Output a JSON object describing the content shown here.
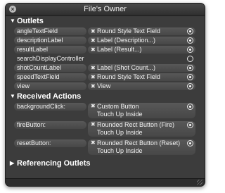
{
  "window": {
    "title": "File's Owner"
  },
  "sections": {
    "outlets": "Outlets",
    "received_actions": "Received Actions",
    "referencing_outlets": "Referencing Outlets"
  },
  "outlets": [
    {
      "name": "angleTextField",
      "target": "Round Style Text Field",
      "connected": true
    },
    {
      "name": "descriptionLabel",
      "target": "Label (Description...)",
      "connected": true
    },
    {
      "name": "resultLabel",
      "target": "Label (Result...)",
      "connected": true
    },
    {
      "name": "searchDisplayController",
      "target": "",
      "connected": false
    },
    {
      "name": "shotCountLabel",
      "target": "Label (Shot Count...)",
      "connected": true
    },
    {
      "name": "speedTextField",
      "target": "Round Style Text Field",
      "connected": true
    },
    {
      "name": "view",
      "target": "View",
      "connected": true
    }
  ],
  "actions": [
    {
      "name": "backgroundClick:",
      "target": "Custom Button",
      "event": "Touch Up Inside"
    },
    {
      "name": "fireButton:",
      "target": "Rounded Rect Button (Fire)",
      "event": "Touch Up Inside"
    },
    {
      "name": "resetButton:",
      "target": "Rounded Rect Button (Reset)",
      "event": "Touch Up Inside"
    }
  ],
  "icons": {
    "close": "close-icon",
    "disclosure_open": "triangle-down-icon",
    "disclosure_closed": "triangle-right-icon",
    "connection": "connection-circle-icon",
    "remove": "x-icon"
  }
}
